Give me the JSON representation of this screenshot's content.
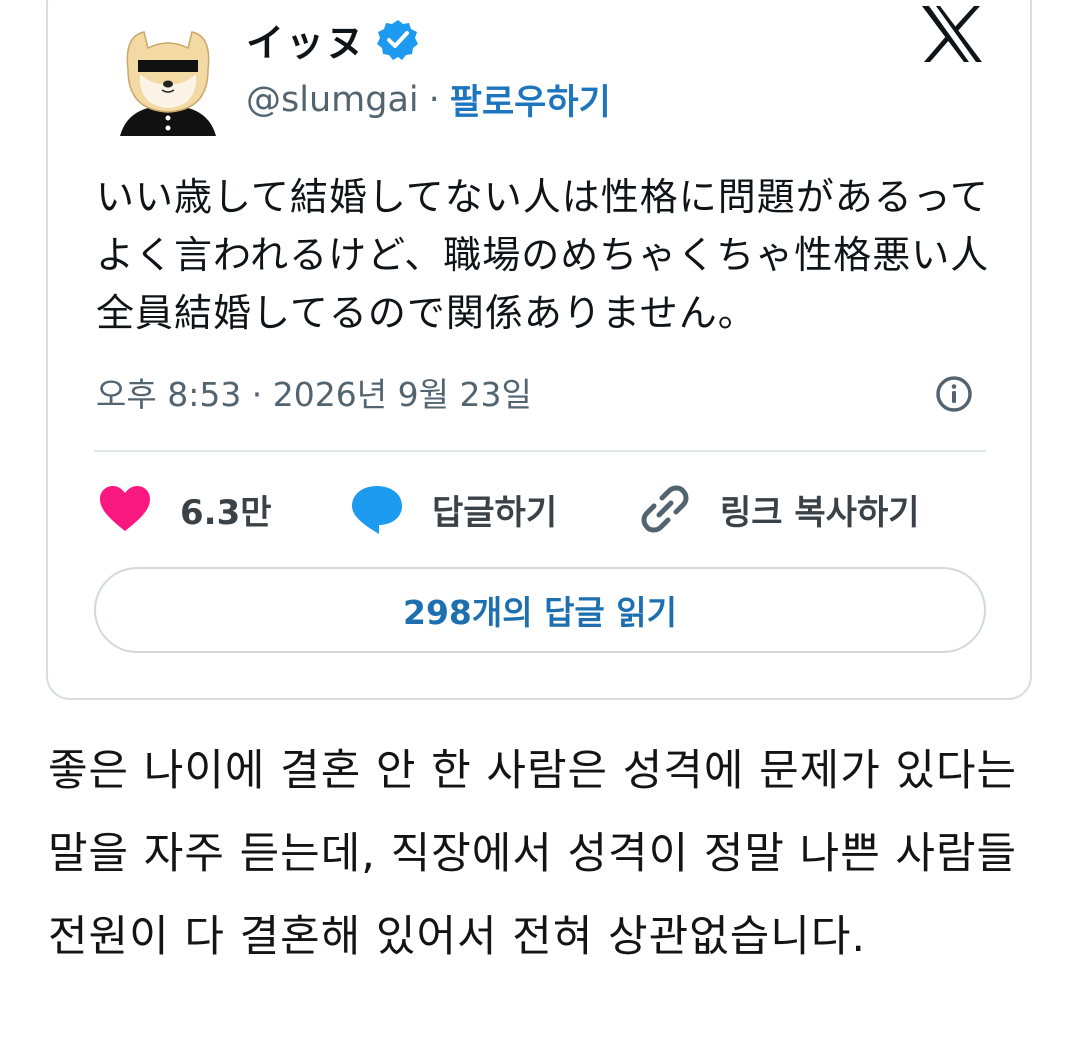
{
  "tweet": {
    "display_name": "イッヌ",
    "handle": "@slumgai",
    "separator": "·",
    "follow_label": "팔로우하기",
    "text": "いい歳して結婚してない人は性格に問題があるってよく言われるけど、職場のめちゃくちゃ性格悪い人全員結婚してるので関係ありません。",
    "timestamp": "오후 8:53 · 2026년 9월 23일",
    "likes": "6.3만",
    "reply_label": "답글하기",
    "copy_link_label": "링크 복사하기",
    "read_replies_label": "298개의 답글 읽기"
  },
  "translation": "좋은 나이에 결혼 안 한 사람은 성격에 문제가 있다는 말을 자주 듣는데, 직장에서 성격이 정말 나쁜 사람들 전원이 다 결혼해 있어서 전혀 상관없습니다.",
  "icons": {
    "verified": "verified-badge-icon",
    "brand": "x-logo-icon",
    "info": "info-icon",
    "like": "heart-icon",
    "reply": "speech-bubble-icon",
    "copy": "link-icon"
  },
  "colors": {
    "accent_blue": "#1d75bf",
    "verified_blue": "#1d9bf0",
    "like_pink": "#f91880",
    "secondary_text": "#536471",
    "border": "#d9dde1"
  }
}
